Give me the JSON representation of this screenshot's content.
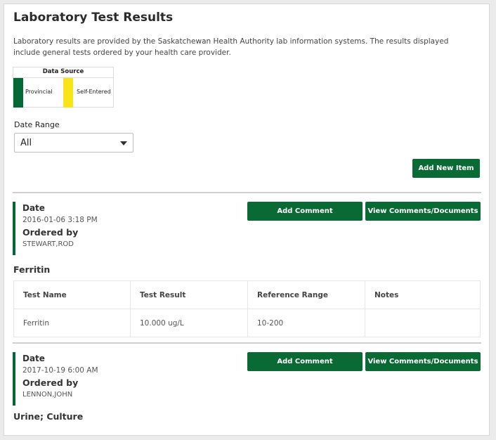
{
  "page": {
    "title": "Laboratory Test Results",
    "intro": "Laboratory results are provided by the Saskatchewan Health Authority lab information systems. The results displayed include general tests ordered by your health care provider."
  },
  "legend": {
    "title": "Data Source",
    "items": [
      {
        "label": "Provincial",
        "color": "#006934"
      },
      {
        "label": "Self-Entered",
        "color": "#f7e51a"
      }
    ]
  },
  "filter": {
    "label": "Date Range",
    "selected": "All"
  },
  "actions": {
    "add_new": "Add New Item",
    "add_comment": "Add Comment",
    "view_comments": "View Comments/Documents"
  },
  "entries": [
    {
      "date_label": "Date",
      "date": "2016-01-06 3:18 PM",
      "ordered_label": "Ordered by",
      "ordered_by": "STEWART,ROD",
      "test_group": "Ferritin",
      "table": {
        "headers": [
          "Test Name",
          "Test Result",
          "Reference Range",
          "Notes"
        ],
        "rows": [
          [
            "Ferritin",
            "10.000 ug/L",
            "10-200",
            ""
          ]
        ]
      }
    },
    {
      "date_label": "Date",
      "date": "2017-10-19 6:00 AM",
      "ordered_label": "Ordered by",
      "ordered_by": "LENNON,JOHN",
      "test_group": "Urine; Culture"
    }
  ],
  "colors": {
    "accent": "#0a6a34",
    "provincial": "#006934",
    "self_entered": "#f7e51a"
  }
}
